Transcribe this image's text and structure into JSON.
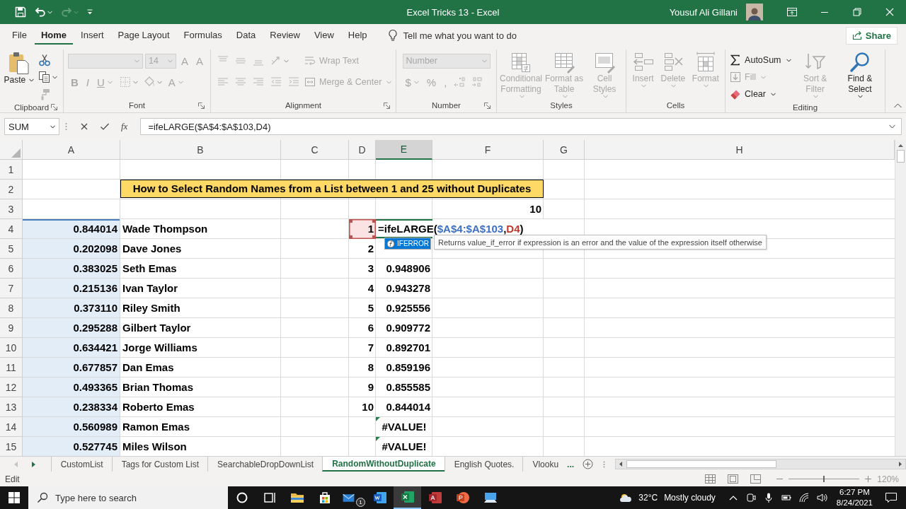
{
  "title_bar": {
    "title": "Excel Tricks 13 - Excel",
    "user_name": "Yousuf Ali Gillani"
  },
  "quick_access": [
    {
      "disabled": false,
      "dropdown": false
    },
    {
      "disabled": false,
      "dropdown": true
    },
    {
      "disabled": true,
      "dropdown": true
    },
    {
      "disabled": false,
      "dropdown": false
    }
  ],
  "menu_tabs": [
    {
      "label": "File",
      "selected": false
    },
    {
      "label": "Home",
      "selected": true
    },
    {
      "label": "Insert",
      "selected": false
    },
    {
      "label": "Page Layout",
      "selected": false
    },
    {
      "label": "Formulas",
      "selected": false
    },
    {
      "label": "Data",
      "selected": false
    },
    {
      "label": "Review",
      "selected": false
    },
    {
      "label": "View",
      "selected": false
    },
    {
      "label": "Help",
      "selected": false
    }
  ],
  "tell_me": {
    "placeholder": "Tell me what you want to do"
  },
  "share_button": "Share",
  "ribbon": {
    "groups": [
      {
        "label": "Clipboard",
        "launcher": true,
        "items": [
          {
            "kind": "large",
            "label": "Paste",
            "disabled": false,
            "dropdown": true
          },
          {
            "kind": "stack",
            "rows": [
              [
                {
                  "kind": "icon",
                  "disabled": false,
                  "dropdown": false
                }
              ],
              [
                {
                  "kind": "icon",
                  "disabled": false,
                  "dropdown": true
                }
              ],
              [
                {
                  "kind": "icon",
                  "disabled": true,
                  "dropdown": false
                }
              ]
            ]
          }
        ]
      },
      {
        "label": "Font",
        "launcher": true,
        "items": [
          {
            "kind": "stack",
            "rows": [
              [
                {
                  "kind": "combo",
                  "disabled": true
                },
                {
                  "kind": "combo",
                  "label": "14",
                  "disabled": true
                },
                {
                  "kind": "glyph",
                  "label": "A",
                  "disabled": true,
                  "dropdown": false
                },
                {
                  "kind": "glyph",
                  "label": "A",
                  "disabled": true,
                  "dropdown": false
                }
              ],
              [
                {
                  "kind": "glyph",
                  "label": "B",
                  "disabled": true,
                  "dropdown": false
                },
                {
                  "kind": "glyph",
                  "label": "I",
                  "disabled": true,
                  "dropdown": false
                },
                {
                  "kind": "glyph",
                  "label": "U",
                  "disabled": true,
                  "dropdown": true
                },
                {
                  "kind": "icon",
                  "disabled": true,
                  "dropdown": true
                },
                {
                  "kind": "icon",
                  "disabled": true,
                  "dropdown": true
                },
                {
                  "kind": "glyph",
                  "label": "A",
                  "disabled": true,
                  "dropdown": true
                }
              ]
            ]
          }
        ]
      },
      {
        "label": "Alignment",
        "launcher": true,
        "items": [
          {
            "kind": "stack",
            "rows": [
              [
                {
                  "kind": "icon",
                  "disabled": true,
                  "dropdown": false
                },
                {
                  "kind": "icon",
                  "disabled": true,
                  "dropdown": false
                },
                {
                  "kind": "icon",
                  "disabled": true,
                  "dropdown": false
                },
                {
                  "kind": "icon",
                  "disabled": true,
                  "dropdown": true
                }
              ],
              [
                {
                  "kind": "icon",
                  "disabled": true,
                  "dropdown": false
                },
                {
                  "kind": "icon",
                  "disabled": true,
                  "dropdown": false
                },
                {
                  "kind": "icon",
                  "disabled": true,
                  "dropdown": false
                },
                {
                  "kind": "icon",
                  "disabled": true,
                  "dropdown": false
                },
                {
                  "kind": "icon",
                  "disabled": true,
                  "dropdown": false
                }
              ]
            ]
          },
          {
            "kind": "stack",
            "rows": [
              [
                {
                  "kind": "small",
                  "label": "Wrap Text",
                  "disabled": true,
                  "dropdown": false
                }
              ],
              [
                {
                  "kind": "small",
                  "label": "Merge & Center",
                  "disabled": true,
                  "dropdown": true
                }
              ]
            ]
          }
        ]
      },
      {
        "label": "Number",
        "launcher": true,
        "items": [
          {
            "kind": "stack",
            "rows": [
              [
                {
                  "kind": "combo",
                  "label": "Number",
                  "disabled": true
                }
              ],
              [
                {
                  "kind": "glyph",
                  "label": "$",
                  "disabled": true,
                  "dropdown": true
                },
                {
                  "kind": "glyph",
                  "label": "%",
                  "disabled": true,
                  "dropdown": false
                },
                {
                  "kind": "glyph",
                  "label": ",",
                  "disabled": true,
                  "dropdown": false
                },
                {
                  "kind": "icon",
                  "disabled": true,
                  "dropdown": false
                },
                {
                  "kind": "icon",
                  "disabled": true,
                  "dropdown": false
                }
              ]
            ]
          }
        ]
      },
      {
        "label": "Styles",
        "launcher": false,
        "items": [
          {
            "kind": "large",
            "label": "Conditional Formatting",
            "disabled": true,
            "dropdown": true
          },
          {
            "kind": "large",
            "label": "Format as Table",
            "disabled": true,
            "dropdown": true
          },
          {
            "kind": "large",
            "label": "Cell Styles",
            "disabled": true,
            "dropdown": true
          }
        ]
      },
      {
        "label": "Cells",
        "launcher": false,
        "items": [
          {
            "kind": "large",
            "label": "Insert",
            "disabled": true,
            "dropdown": true
          },
          {
            "kind": "large",
            "label": "Delete",
            "disabled": true,
            "dropdown": true
          },
          {
            "kind": "large",
            "label": "Format",
            "disabled": true,
            "dropdown": true
          }
        ]
      },
      {
        "label": "Editing",
        "launcher": false,
        "items": [
          {
            "kind": "stack",
            "rows": [
              [
                {
                  "kind": "small",
                  "label": "AutoSum",
                  "disabled": false,
                  "dropdown": true
                }
              ],
              [
                {
                  "kind": "small",
                  "label": "Fill",
                  "disabled": true,
                  "dropdown": true
                }
              ],
              [
                {
                  "kind": "small",
                  "label": "Clear",
                  "disabled": false,
                  "dropdown": true
                }
              ]
            ]
          },
          {
            "kind": "large",
            "label": "Sort & Filter",
            "disabled": true,
            "dropdown": true
          },
          {
            "kind": "large",
            "label": "Find & Select",
            "disabled": false,
            "dropdown": true
          }
        ]
      }
    ]
  },
  "formula_bar": {
    "name_box": "SUM",
    "insert_function": "fx",
    "formula": "=ifeLARGE($A$4:$A$103,D4)"
  },
  "columns": [
    {
      "label": "A",
      "selected": false
    },
    {
      "label": "B",
      "selected": false
    },
    {
      "label": "C",
      "selected": false
    },
    {
      "label": "D",
      "selected": false
    },
    {
      "label": "E",
      "selected": true
    },
    {
      "label": "F",
      "selected": false
    },
    {
      "label": "G",
      "selected": false
    },
    {
      "label": "H",
      "selected": false
    }
  ],
  "rows": [
    {
      "label": "1",
      "a_referenced": false,
      "d_referenced": false,
      "e_error": false
    },
    {
      "label": "2",
      "title": "How to Select Random Names from a List between 1 and 25 without Duplicates",
      "a_referenced": false,
      "d_referenced": false,
      "e_error": false
    },
    {
      "label": "3",
      "f": "10",
      "a_referenced": false,
      "d_referenced": false,
      "e_error": false
    },
    {
      "label": "4",
      "a": "0.844014",
      "b": "Wade Thompson",
      "d": "1",
      "e_formula": [
        {
          "text": "=ifeLARGE(",
          "color": "#000000"
        },
        {
          "text": "$A$4:$A$103",
          "color": "#3d6fc4"
        },
        {
          "text": ",",
          "color": "#000000"
        },
        {
          "text": "D4",
          "color": "#c0392b"
        },
        {
          "text": ")",
          "color": "#000000"
        }
      ],
      "a_referenced": true,
      "d_referenced": true,
      "e_error": false
    },
    {
      "label": "5",
      "a": "0.202098",
      "b": "Dave Jones",
      "d": "2",
      "a_referenced": true,
      "d_referenced": false,
      "e_error": false
    },
    {
      "label": "6",
      "a": "0.383025",
      "b": "Seth Emas",
      "d": "3",
      "e": "0.948906",
      "a_referenced": true,
      "d_referenced": false,
      "e_error": false
    },
    {
      "label": "7",
      "a": "0.215136",
      "b": "Ivan Taylor",
      "d": "4",
      "e": "0.943278",
      "a_referenced": true,
      "d_referenced": false,
      "e_error": false
    },
    {
      "label": "8",
      "a": "0.373110",
      "b": "Riley Smith",
      "d": "5",
      "e": "0.925556",
      "a_referenced": true,
      "d_referenced": false,
      "e_error": false
    },
    {
      "label": "9",
      "a": "0.295288",
      "b": "Gilbert Taylor",
      "d": "6",
      "e": "0.909772",
      "a_referenced": true,
      "d_referenced": false,
      "e_error": false
    },
    {
      "label": "10",
      "a": "0.634421",
      "b": "Jorge Williams",
      "d": "7",
      "e": "0.892701",
      "a_referenced": true,
      "d_referenced": false,
      "e_error": false
    },
    {
      "label": "11",
      "a": "0.677857",
      "b": "Dan Emas",
      "d": "8",
      "e": "0.859196",
      "a_referenced": true,
      "d_referenced": false,
      "e_error": false
    },
    {
      "label": "12",
      "a": "0.493365",
      "b": "Brian Thomas",
      "d": "9",
      "e": "0.855585",
      "a_referenced": true,
      "d_referenced": false,
      "e_error": false
    },
    {
      "label": "13",
      "a": "0.238334",
      "b": "Roberto Emas",
      "d": "10",
      "e": "0.844014",
      "a_referenced": true,
      "d_referenced": false,
      "e_error": false
    },
    {
      "label": "14",
      "a": "0.560989",
      "b": "Ramon Emas",
      "e": "#VALUE!",
      "a_referenced": true,
      "d_referenced": false,
      "e_error": true
    },
    {
      "label": "15",
      "a": "0.527745",
      "b": "Miles Wilson",
      "e": "#VALUE!",
      "a_referenced": true,
      "d_referenced": false,
      "e_error": true
    }
  ],
  "autocomplete": {
    "items": [
      {
        "label": "IFERROR",
        "selected": true
      }
    ],
    "tooltip": "Returns value_if_error if expression is an error and the value of the expression itself otherwise"
  },
  "sheet_tabs": [
    {
      "label": "CustomList",
      "selected": false
    },
    {
      "label": "Tags for Custom List",
      "selected": false
    },
    {
      "label": "SearchableDropDownList",
      "selected": false
    },
    {
      "label": "RandomWithoutDuplicate",
      "selected": true
    },
    {
      "label": "English Quotes.",
      "selected": false
    },
    {
      "label": "Vlooku",
      "selected": false
    }
  ],
  "more_tabs": "...",
  "status_bar": {
    "mode": "Edit",
    "zoom": {
      "level": 0.5,
      "reading": "120%"
    }
  },
  "taskbar": {
    "search_placeholder": "Type here to search",
    "apps": [
      {
        "active": false
      },
      {
        "active": false
      },
      {
        "active": false
      },
      {
        "active": false
      },
      {
        "active": false,
        "badge": "1"
      },
      {
        "active": false
      },
      {
        "active": true
      },
      {
        "active": false
      },
      {
        "active": false
      },
      {
        "active": false
      }
    ],
    "weather": {
      "temperature": "32°C",
      "condition": "Mostly cloudy"
    },
    "clock": {
      "time": "6:27 PM",
      "date": "8/24/2021"
    }
  }
}
